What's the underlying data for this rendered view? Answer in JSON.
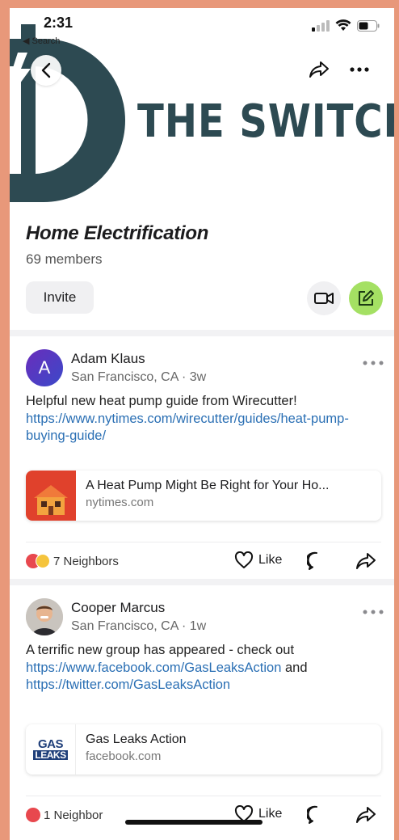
{
  "status": {
    "time": "2:31",
    "back_label": "◀ Search"
  },
  "banner": {
    "text": "THE SWITCH IS"
  },
  "group": {
    "title": "Home Electrification",
    "members": "69 members",
    "invite_label": "Invite"
  },
  "posts": [
    {
      "author": "Adam Klaus",
      "avatar_letter": "A",
      "location": "San Francisco, CA",
      "age": "3w",
      "text_plain": "Helpful new heat pump guide from Wirecutter! ",
      "link_1": "https://www.nytimes.com/wirecutter/guides/heat-pump-buying-guide/",
      "card": {
        "title": "A Heat Pump Might Be Right for Your Ho...",
        "domain": "nytimes.com"
      },
      "reactions": "7 Neighbors",
      "like_label": "Like"
    },
    {
      "author": "Cooper Marcus",
      "location": "San Francisco, CA",
      "age": "1w",
      "text_plain": "A terrific new group has appeared - check out ",
      "link_1": "https://www.facebook.com/GasLeaksAction",
      "text_mid": " and ",
      "link_2": "https://twitter.com/GasLeaksAction",
      "card": {
        "title": "Gas Leaks Action",
        "domain": "facebook.com",
        "logo_top": "GAS",
        "logo_bottom": "LEAKS"
      },
      "reactions": "1 Neighbor",
      "like_label": "Like"
    }
  ],
  "separator": "·",
  "colors": {
    "brand_dark": "#2d4a52",
    "compose_green": "#a4e063",
    "link": "#2a6fb4",
    "background": "#e8987a"
  }
}
